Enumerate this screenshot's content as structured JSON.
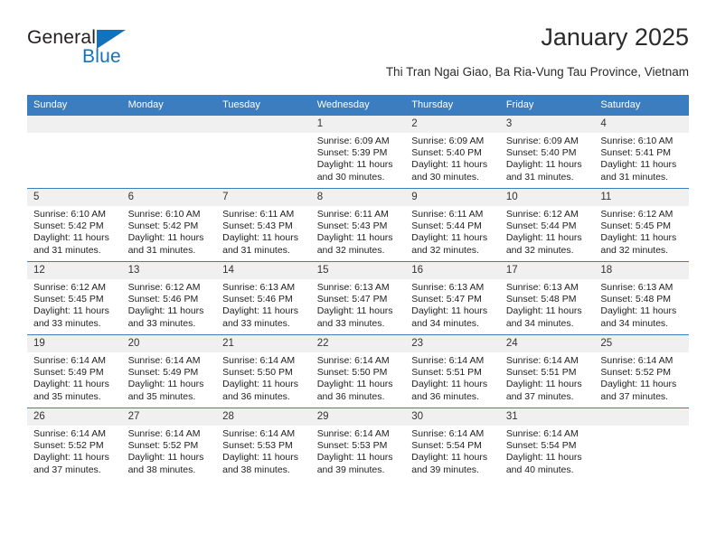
{
  "logo": {
    "word1": "General",
    "word2": "Blue",
    "triangle_color": "#1272bb",
    "word1_color": "#231f20",
    "word2_color": "#1272bb"
  },
  "header": {
    "title": "January 2025",
    "subtitle": "Thi Tran Ngai Giao, Ba Ria-Vung Tau Province, Vietnam"
  },
  "theme": {
    "header_row_bg": "#3b7dbf",
    "header_row_text": "#ffffff",
    "daynum_bg": "#f0f0f0",
    "row_divider": "#3b7dbf",
    "body_bg": "#ffffff"
  },
  "weekdays": [
    "Sunday",
    "Monday",
    "Tuesday",
    "Wednesday",
    "Thursday",
    "Friday",
    "Saturday"
  ],
  "weeks": [
    [
      {
        "day": "",
        "empty": true
      },
      {
        "day": "",
        "empty": true
      },
      {
        "day": "",
        "empty": true
      },
      {
        "day": "1",
        "sunrise": "Sunrise: 6:09 AM",
        "sunset": "Sunset: 5:39 PM",
        "daylight1": "Daylight: 11 hours",
        "daylight2": "and 30 minutes."
      },
      {
        "day": "2",
        "sunrise": "Sunrise: 6:09 AM",
        "sunset": "Sunset: 5:40 PM",
        "daylight1": "Daylight: 11 hours",
        "daylight2": "and 30 minutes."
      },
      {
        "day": "3",
        "sunrise": "Sunrise: 6:09 AM",
        "sunset": "Sunset: 5:40 PM",
        "daylight1": "Daylight: 11 hours",
        "daylight2": "and 31 minutes."
      },
      {
        "day": "4",
        "sunrise": "Sunrise: 6:10 AM",
        "sunset": "Sunset: 5:41 PM",
        "daylight1": "Daylight: 11 hours",
        "daylight2": "and 31 minutes."
      }
    ],
    [
      {
        "day": "5",
        "sunrise": "Sunrise: 6:10 AM",
        "sunset": "Sunset: 5:42 PM",
        "daylight1": "Daylight: 11 hours",
        "daylight2": "and 31 minutes."
      },
      {
        "day": "6",
        "sunrise": "Sunrise: 6:10 AM",
        "sunset": "Sunset: 5:42 PM",
        "daylight1": "Daylight: 11 hours",
        "daylight2": "and 31 minutes."
      },
      {
        "day": "7",
        "sunrise": "Sunrise: 6:11 AM",
        "sunset": "Sunset: 5:43 PM",
        "daylight1": "Daylight: 11 hours",
        "daylight2": "and 31 minutes."
      },
      {
        "day": "8",
        "sunrise": "Sunrise: 6:11 AM",
        "sunset": "Sunset: 5:43 PM",
        "daylight1": "Daylight: 11 hours",
        "daylight2": "and 32 minutes."
      },
      {
        "day": "9",
        "sunrise": "Sunrise: 6:11 AM",
        "sunset": "Sunset: 5:44 PM",
        "daylight1": "Daylight: 11 hours",
        "daylight2": "and 32 minutes."
      },
      {
        "day": "10",
        "sunrise": "Sunrise: 6:12 AM",
        "sunset": "Sunset: 5:44 PM",
        "daylight1": "Daylight: 11 hours",
        "daylight2": "and 32 minutes."
      },
      {
        "day": "11",
        "sunrise": "Sunrise: 6:12 AM",
        "sunset": "Sunset: 5:45 PM",
        "daylight1": "Daylight: 11 hours",
        "daylight2": "and 32 minutes."
      }
    ],
    [
      {
        "day": "12",
        "sunrise": "Sunrise: 6:12 AM",
        "sunset": "Sunset: 5:45 PM",
        "daylight1": "Daylight: 11 hours",
        "daylight2": "and 33 minutes."
      },
      {
        "day": "13",
        "sunrise": "Sunrise: 6:12 AM",
        "sunset": "Sunset: 5:46 PM",
        "daylight1": "Daylight: 11 hours",
        "daylight2": "and 33 minutes."
      },
      {
        "day": "14",
        "sunrise": "Sunrise: 6:13 AM",
        "sunset": "Sunset: 5:46 PM",
        "daylight1": "Daylight: 11 hours",
        "daylight2": "and 33 minutes."
      },
      {
        "day": "15",
        "sunrise": "Sunrise: 6:13 AM",
        "sunset": "Sunset: 5:47 PM",
        "daylight1": "Daylight: 11 hours",
        "daylight2": "and 33 minutes."
      },
      {
        "day": "16",
        "sunrise": "Sunrise: 6:13 AM",
        "sunset": "Sunset: 5:47 PM",
        "daylight1": "Daylight: 11 hours",
        "daylight2": "and 34 minutes."
      },
      {
        "day": "17",
        "sunrise": "Sunrise: 6:13 AM",
        "sunset": "Sunset: 5:48 PM",
        "daylight1": "Daylight: 11 hours",
        "daylight2": "and 34 minutes."
      },
      {
        "day": "18",
        "sunrise": "Sunrise: 6:13 AM",
        "sunset": "Sunset: 5:48 PM",
        "daylight1": "Daylight: 11 hours",
        "daylight2": "and 34 minutes."
      }
    ],
    [
      {
        "day": "19",
        "sunrise": "Sunrise: 6:14 AM",
        "sunset": "Sunset: 5:49 PM",
        "daylight1": "Daylight: 11 hours",
        "daylight2": "and 35 minutes."
      },
      {
        "day": "20",
        "sunrise": "Sunrise: 6:14 AM",
        "sunset": "Sunset: 5:49 PM",
        "daylight1": "Daylight: 11 hours",
        "daylight2": "and 35 minutes."
      },
      {
        "day": "21",
        "sunrise": "Sunrise: 6:14 AM",
        "sunset": "Sunset: 5:50 PM",
        "daylight1": "Daylight: 11 hours",
        "daylight2": "and 36 minutes."
      },
      {
        "day": "22",
        "sunrise": "Sunrise: 6:14 AM",
        "sunset": "Sunset: 5:50 PM",
        "daylight1": "Daylight: 11 hours",
        "daylight2": "and 36 minutes."
      },
      {
        "day": "23",
        "sunrise": "Sunrise: 6:14 AM",
        "sunset": "Sunset: 5:51 PM",
        "daylight1": "Daylight: 11 hours",
        "daylight2": "and 36 minutes."
      },
      {
        "day": "24",
        "sunrise": "Sunrise: 6:14 AM",
        "sunset": "Sunset: 5:51 PM",
        "daylight1": "Daylight: 11 hours",
        "daylight2": "and 37 minutes."
      },
      {
        "day": "25",
        "sunrise": "Sunrise: 6:14 AM",
        "sunset": "Sunset: 5:52 PM",
        "daylight1": "Daylight: 11 hours",
        "daylight2": "and 37 minutes."
      }
    ],
    [
      {
        "day": "26",
        "sunrise": "Sunrise: 6:14 AM",
        "sunset": "Sunset: 5:52 PM",
        "daylight1": "Daylight: 11 hours",
        "daylight2": "and 37 minutes."
      },
      {
        "day": "27",
        "sunrise": "Sunrise: 6:14 AM",
        "sunset": "Sunset: 5:52 PM",
        "daylight1": "Daylight: 11 hours",
        "daylight2": "and 38 minutes."
      },
      {
        "day": "28",
        "sunrise": "Sunrise: 6:14 AM",
        "sunset": "Sunset: 5:53 PM",
        "daylight1": "Daylight: 11 hours",
        "daylight2": "and 38 minutes."
      },
      {
        "day": "29",
        "sunrise": "Sunrise: 6:14 AM",
        "sunset": "Sunset: 5:53 PM",
        "daylight1": "Daylight: 11 hours",
        "daylight2": "and 39 minutes."
      },
      {
        "day": "30",
        "sunrise": "Sunrise: 6:14 AM",
        "sunset": "Sunset: 5:54 PM",
        "daylight1": "Daylight: 11 hours",
        "daylight2": "and 39 minutes."
      },
      {
        "day": "31",
        "sunrise": "Sunrise: 6:14 AM",
        "sunset": "Sunset: 5:54 PM",
        "daylight1": "Daylight: 11 hours",
        "daylight2": "and 40 minutes."
      },
      {
        "day": "",
        "empty": true
      }
    ]
  ]
}
